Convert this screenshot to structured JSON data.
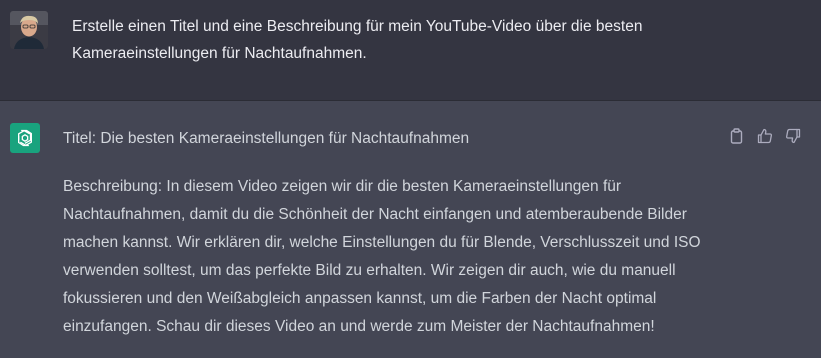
{
  "user_message": {
    "avatar_icon": "user-avatar-photo",
    "text_line1": "Erstelle einen Titel und eine Beschreibung für mein YouTube-Video über die besten",
    "text_line2": "Kameraeinstellungen für Nachtaufnahmen."
  },
  "assistant_message": {
    "avatar_icon": "openai-logo-icon",
    "avatar_color": "#19a37e",
    "title_line": "Titel: Die besten Kameraeinstellungen für Nachtaufnahmen",
    "description": [
      "Beschreibung: In diesem Video zeigen wir dir die besten Kameraeinstellungen für",
      "Nachtaufnahmen, damit du die Schönheit der Nacht einfangen und atemberaubende Bilder",
      "machen kannst. Wir erklären dir, welche Einstellungen du für Blende, Verschlusszeit und ISO",
      "verwenden solltest, um das perfekte Bild zu erhalten. Wir zeigen dir auch, wie du manuell",
      "fokussieren und den Weißabgleich anpassen kannst, um die Farben der Nacht optimal",
      "einzufangen. Schau dir dieses Video an und werde zum Meister der Nachtaufnahmen!"
    ],
    "actions": [
      "copy-icon",
      "thumbs-up-icon",
      "thumbs-down-icon"
    ]
  },
  "colors": {
    "user_bg": "#343541",
    "assistant_bg": "#444654",
    "text": "#d1d5db",
    "icon": "#acacbe"
  }
}
